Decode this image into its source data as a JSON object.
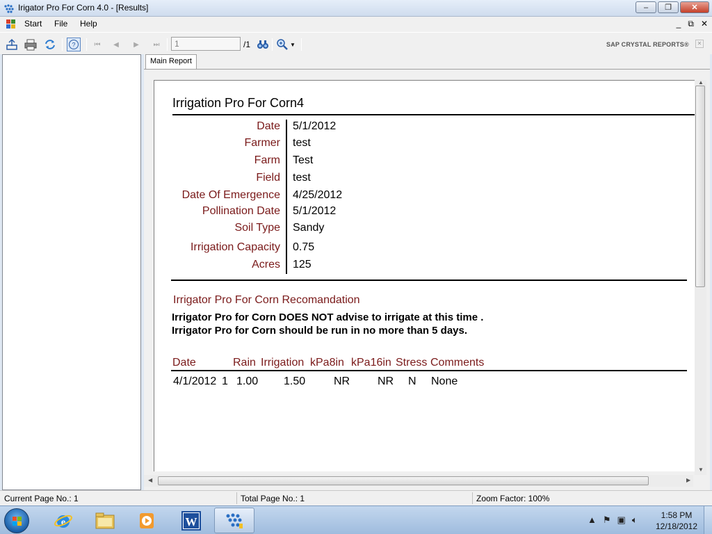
{
  "window": {
    "title": "Irigator Pro For Corn 4.0 - [Results]",
    "minimize": "‒",
    "maximize": "❐",
    "close": "✕"
  },
  "menu": {
    "items": [
      "Start",
      "File",
      "Help"
    ],
    "mdi_minimize": "_",
    "mdi_restore": "⧉",
    "mdi_close": "✕"
  },
  "toolbar": {
    "page_value": "1",
    "page_total": "/1",
    "brand": "SAP CRYSTAL REPORTS®"
  },
  "tabs": [
    "Main Report"
  ],
  "report": {
    "title": "Irrigation Pro For Corn4",
    "fields": [
      {
        "label": "Date",
        "value": "5/1/2012"
      },
      {
        "label": "Farmer",
        "value": "test"
      },
      {
        "label": "Farm",
        "value": "Test"
      },
      {
        "label": "Field",
        "value": "test"
      },
      {
        "label": "Date Of Emergence",
        "value": "4/25/2012"
      },
      {
        "label": "Pollination Date",
        "value": "5/1/2012"
      },
      {
        "label": "Soil Type",
        "value": "Sandy"
      },
      {
        "label": "Irrigation Capacity",
        "value": "0.75"
      },
      {
        "label": "Acres",
        "value": "125"
      }
    ],
    "recommendation_heading": "Irrigator Pro For Corn Recomandation",
    "recommendation_lines": [
      "Irrigator Pro for Corn DOES NOT advise to irrigate at this time  .",
      "Irrigator Pro for Corn should be run in no more than  5 days."
    ],
    "table": {
      "headers": [
        "Date",
        "Rain",
        "Irrigation",
        "kPa8in",
        "kPa16in",
        "Stress",
        "Comments"
      ],
      "rows": [
        [
          "4/1/2012",
          "1",
          "1.00",
          "1.50",
          "NR",
          "NR",
          "N",
          "None"
        ]
      ]
    }
  },
  "status": {
    "current_page": "Current Page No.: 1",
    "total_page": "Total Page No.: 1",
    "zoom": "Zoom Factor: 100%"
  },
  "taskbar": {
    "time": "1:58 PM",
    "date": "12/18/2012"
  },
  "colors": {
    "label_red": "#7a1a1a",
    "titlebar": "#dbe6f4",
    "taskbar": "#b6cde8"
  }
}
